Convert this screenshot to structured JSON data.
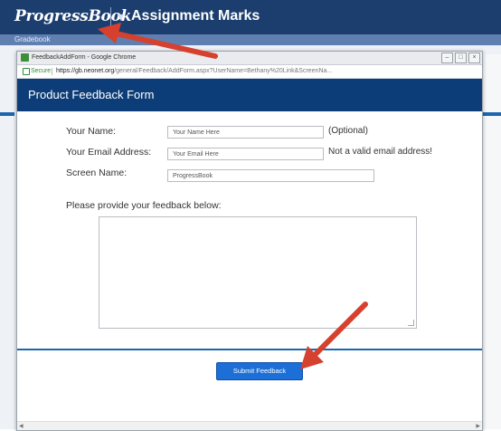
{
  "app": {
    "brand": "ProgressBook",
    "caret": "▾",
    "title": "Assignment Marks",
    "subbar": "Gradebook"
  },
  "window": {
    "title": "FeedbackAddForm - Google Chrome",
    "buttons": [
      "–",
      "□",
      "×"
    ],
    "secure_label": "Secure",
    "url_host": "https://gb.neonet.org",
    "url_path": "/general/Feedback/AddForm.aspx?UserName=Bethany%20Link&ScreenNa..."
  },
  "form": {
    "header": "Product Feedback Form",
    "name_label": "Your Name:",
    "name_value": "Your Name Here",
    "name_note": "(Optional)",
    "email_label": "Your Email Address:",
    "email_value": "Your Email Here",
    "email_note": "Not a valid email address!",
    "screen_label": "Screen Name:",
    "screen_value": "ProgressBook",
    "feedback_prompt": "Please provide your feedback below:",
    "submit_label": "Submit Feedback"
  },
  "colors": {
    "header_navy": "#1b3e6f",
    "form_header": "#0d3d78",
    "submit_blue": "#1c6fd6",
    "arrow_red": "#d6402e"
  }
}
